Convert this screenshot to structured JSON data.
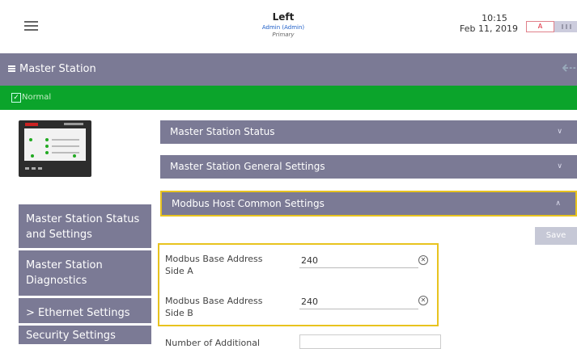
{
  "header": {
    "title": "Left",
    "user": "Admin (Admin)",
    "role": "Primary",
    "time": "10:15",
    "date": "Feb 11, 2019",
    "switch_label": "A"
  },
  "titlebar": {
    "label": "Master Station"
  },
  "status": {
    "text": "Normal",
    "color": "#0ba42b"
  },
  "nav": [
    {
      "label_line1": "Master Station Status",
      "label_line2": "and Settings"
    },
    {
      "label_line1": "Master Station",
      "label_line2": "Diagnostics"
    },
    {
      "label_line1": "> Ethernet Settings"
    },
    {
      "label_line1": "Security Settings"
    }
  ],
  "accordion": [
    {
      "label": "Master Station Status",
      "expanded": false
    },
    {
      "label": "Master Station General Settings",
      "expanded": false
    },
    {
      "label": "Modbus Host Common Settings",
      "expanded": true
    }
  ],
  "save_label": "Save",
  "fields": [
    {
      "label_line1": "Modbus Base Address",
      "label_line2": "Side A",
      "value": "240"
    },
    {
      "label_line1": "Modbus Base Address",
      "label_line2": "Side B",
      "value": "240"
    },
    {
      "label_line1": "Number of Additional",
      "value": ""
    }
  ],
  "colors": {
    "accent": "#7b7a95",
    "highlight": "#e8c31f",
    "status_ok": "#0ba42b"
  }
}
